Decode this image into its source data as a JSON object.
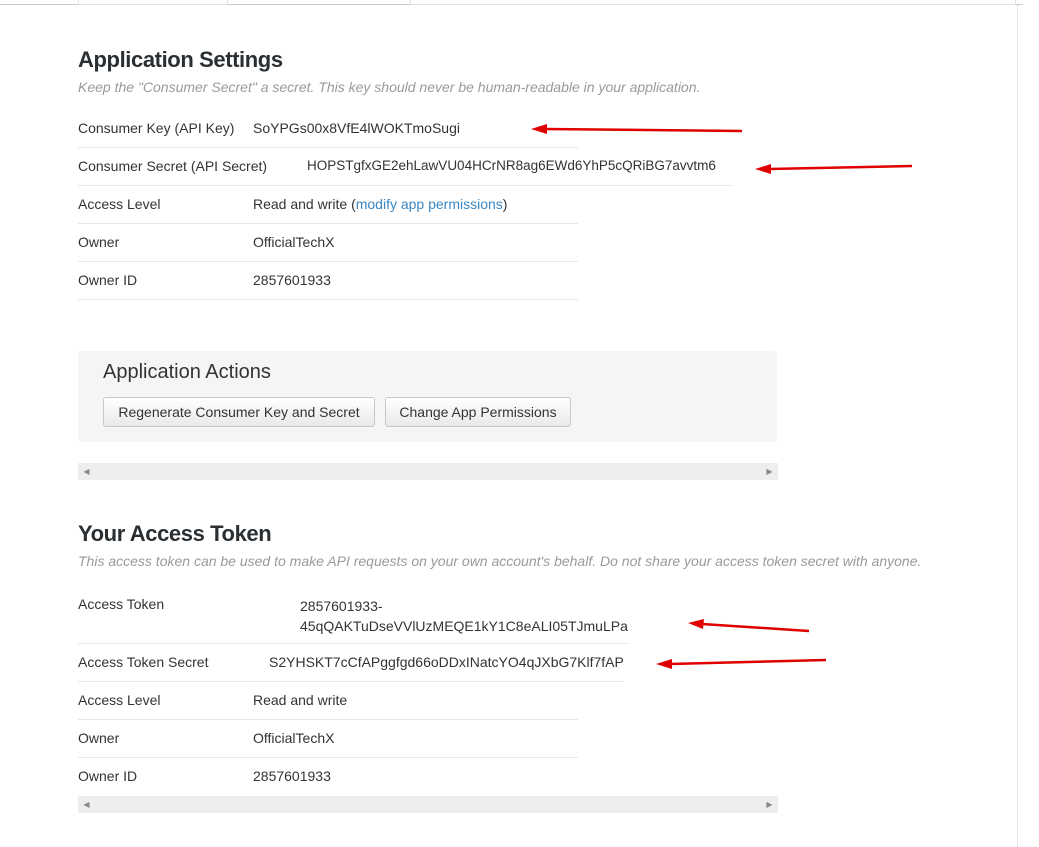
{
  "settings": {
    "title": "Application Settings",
    "description": "Keep the \"Consumer Secret\" a secret. This key should never be human-readable in your application.",
    "consumer_key_label": "Consumer Key (API Key)",
    "consumer_key_value": "SoYPGs00x8VfE4lWOKTmoSugi",
    "consumer_secret_label": "Consumer Secret (API Secret)",
    "consumer_secret_value": "HOPSTgfxGE2ehLawVU04HCrNR8ag6EWd6YhP5cQRiBG7avvtm6",
    "access_level_label": "Access Level",
    "access_level_value": "Read and write",
    "access_level_paren_open": "(",
    "modify_link": "modify app permissions",
    "access_level_paren_close": ")",
    "owner_label": "Owner",
    "owner_value": "OfficialTechX",
    "owner_id_label": "Owner ID",
    "owner_id_value": "2857601933"
  },
  "actions": {
    "title": "Application Actions",
    "regenerate_button": "Regenerate Consumer Key and Secret",
    "change_permissions_button": "Change App Permissions"
  },
  "token": {
    "title": "Your Access Token",
    "description": "This access token can be used to make API requests on your own account's behalf. Do not share your access token secret with anyone.",
    "access_token_label": "Access Token",
    "access_token_line1": "2857601933-",
    "access_token_line2": "45qQAKTuDseVVlUzMEQE1kY1C8eALI05TJmuLPa",
    "access_token_secret_label": "Access Token Secret",
    "access_token_secret_value": "S2YHSKT7cCfAPggfgd66oDDxINatcYO4qJXbG7Klf7fAP",
    "access_level_label": "Access Level",
    "access_level_value": "Read and write",
    "owner_label": "Owner",
    "owner_value": "OfficialTechX",
    "owner_id_label": "Owner ID",
    "owner_id_value": "2857601933"
  },
  "icons": {
    "scroll_left": "scroll-left-icon",
    "scroll_right": "scroll-right-icon",
    "annotation_arrow": "red-arrow-icon"
  },
  "colors": {
    "link": "#3b88c3",
    "annotation": "#e00000",
    "panel_bg": "#f5f5f5"
  }
}
